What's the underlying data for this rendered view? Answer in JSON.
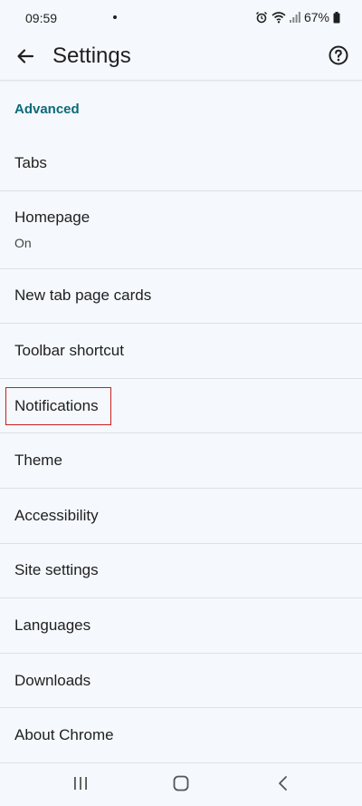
{
  "status_bar": {
    "time": "09:59",
    "battery": "67%"
  },
  "app_bar": {
    "title": "Settings"
  },
  "section": {
    "header": "Advanced"
  },
  "items": [
    {
      "label": "Tabs"
    },
    {
      "label": "Homepage",
      "sub": "On"
    },
    {
      "label": "New tab page cards"
    },
    {
      "label": "Toolbar shortcut"
    },
    {
      "label": "Notifications"
    },
    {
      "label": "Theme"
    },
    {
      "label": "Accessibility"
    },
    {
      "label": "Site settings"
    },
    {
      "label": "Languages"
    },
    {
      "label": "Downloads"
    },
    {
      "label": "About Chrome"
    }
  ],
  "icons": {
    "back": "arrow-back-icon",
    "help": "help-circle-icon",
    "alarm": "alarm-icon",
    "wifi": "wifi-icon",
    "signal": "signal-icon",
    "battery": "battery-icon",
    "recents": "recents-icon",
    "home": "home-icon",
    "nav_back": "nav-back-icon"
  },
  "colors": {
    "accent": "#0b6a7a",
    "highlight": "#cc1f1f"
  }
}
